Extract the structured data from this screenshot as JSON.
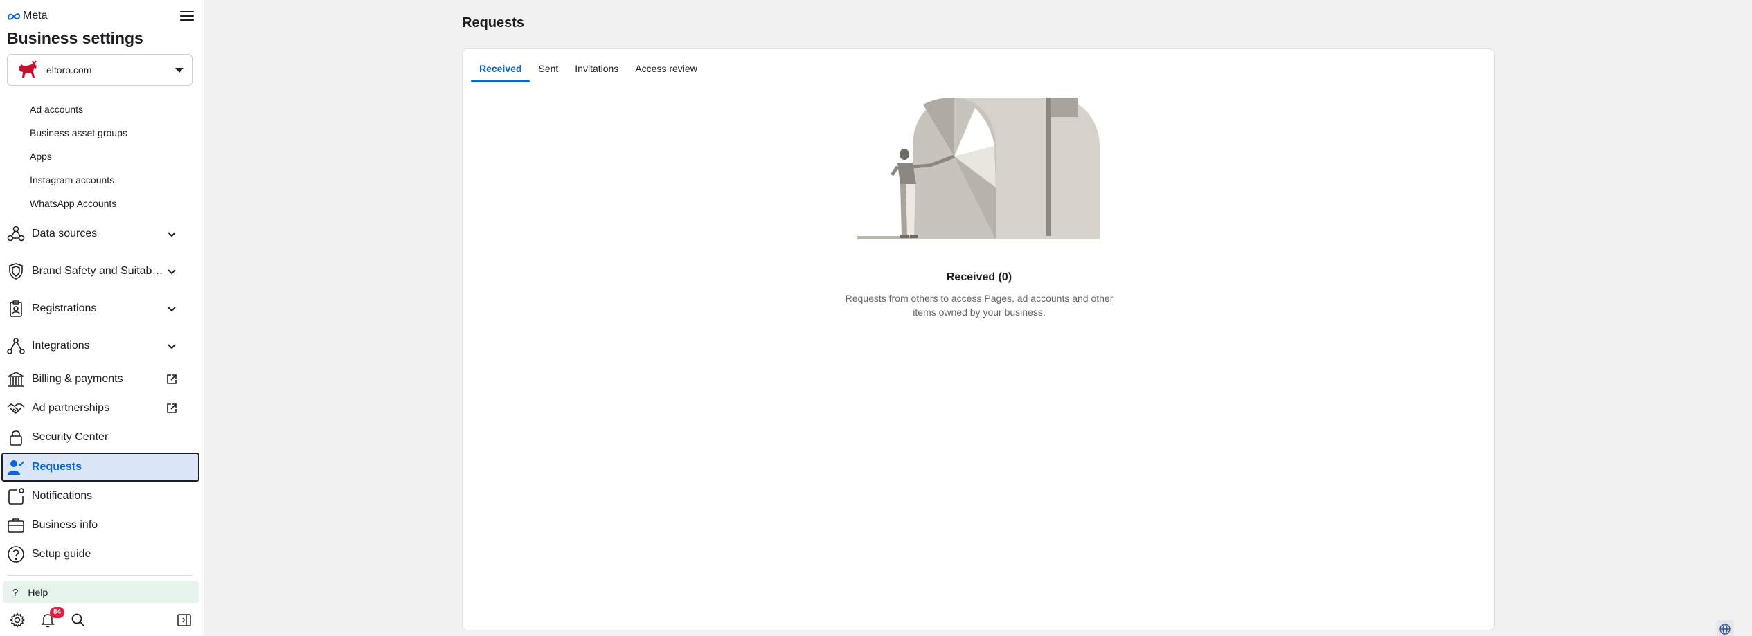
{
  "brand": {
    "name": "Meta"
  },
  "sidebar": {
    "title": "Business settings",
    "account": {
      "name": "eltoro.com"
    },
    "sub_items": [
      {
        "label": "Ad accounts"
      },
      {
        "label": "Business asset groups"
      },
      {
        "label": "Apps"
      },
      {
        "label": "Instagram accounts"
      },
      {
        "label": "WhatsApp Accounts"
      }
    ],
    "nav": [
      {
        "label": "Data sources",
        "icon": "data-sources-icon",
        "trail": "chevron-down-icon"
      },
      {
        "label": "Brand Safety and Suitabi...",
        "icon": "shield-icon",
        "trail": "chevron-down-icon"
      },
      {
        "label": "Registrations",
        "icon": "clipboard-icon",
        "trail": "chevron-down-icon"
      },
      {
        "label": "Integrations",
        "icon": "integrations-icon",
        "trail": "chevron-down-icon"
      },
      {
        "label": "Billing & payments",
        "icon": "bank-icon",
        "trail": "external-link-icon"
      },
      {
        "label": "Ad partnerships",
        "icon": "handshake-icon",
        "trail": "external-link-icon"
      },
      {
        "label": "Security Center",
        "icon": "lock-icon",
        "trail": ""
      },
      {
        "label": "Requests",
        "icon": "person-check-icon",
        "trail": "",
        "active": true
      },
      {
        "label": "Notifications",
        "icon": "notifications-icon",
        "trail": ""
      },
      {
        "label": "Business info",
        "icon": "briefcase-icon",
        "trail": ""
      },
      {
        "label": "Setup guide",
        "icon": "question-circle-icon",
        "trail": ""
      }
    ],
    "help": {
      "icon": "?",
      "label": "Help"
    },
    "bottom": {
      "notification_count": "84"
    }
  },
  "main": {
    "title": "Requests",
    "tabs": [
      {
        "label": "Received",
        "active": true
      },
      {
        "label": "Sent"
      },
      {
        "label": "Invitations"
      },
      {
        "label": "Access review"
      }
    ],
    "empty_state": {
      "title": "Received (0)",
      "description": "Requests from others to access Pages, ad accounts and other items owned by your business."
    }
  },
  "colors": {
    "accent": "#0866d9",
    "active_bg": "#dbe7f7",
    "help_bg": "#e6f4ec",
    "badge": "#e41e3f"
  }
}
